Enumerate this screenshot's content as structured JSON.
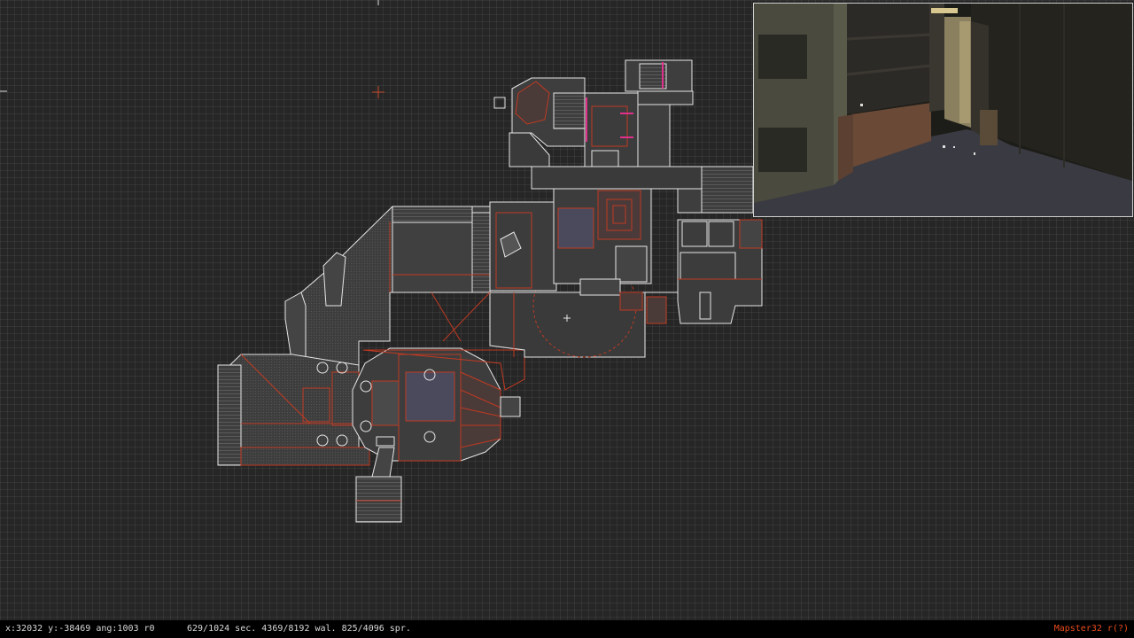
{
  "status": {
    "coords": "x:32032 y:-38469 ang:1003 r0",
    "counts": "629/1024 sec. 4369/8192 wal. 825/4096 spr.",
    "version": "Mapster32 r(?)"
  },
  "colors": {
    "background": "#262626",
    "wall_white": "#e6e6e6",
    "wall_red": "#c03a22",
    "sector_fill": "#3b3b3b",
    "highlight_magenta": "#e0308a",
    "status_text": "#d8d8d8",
    "version_text": "#e84c1c"
  },
  "icons": {
    "cursor": "crosshair-icon",
    "player": "player-marker-icon"
  }
}
